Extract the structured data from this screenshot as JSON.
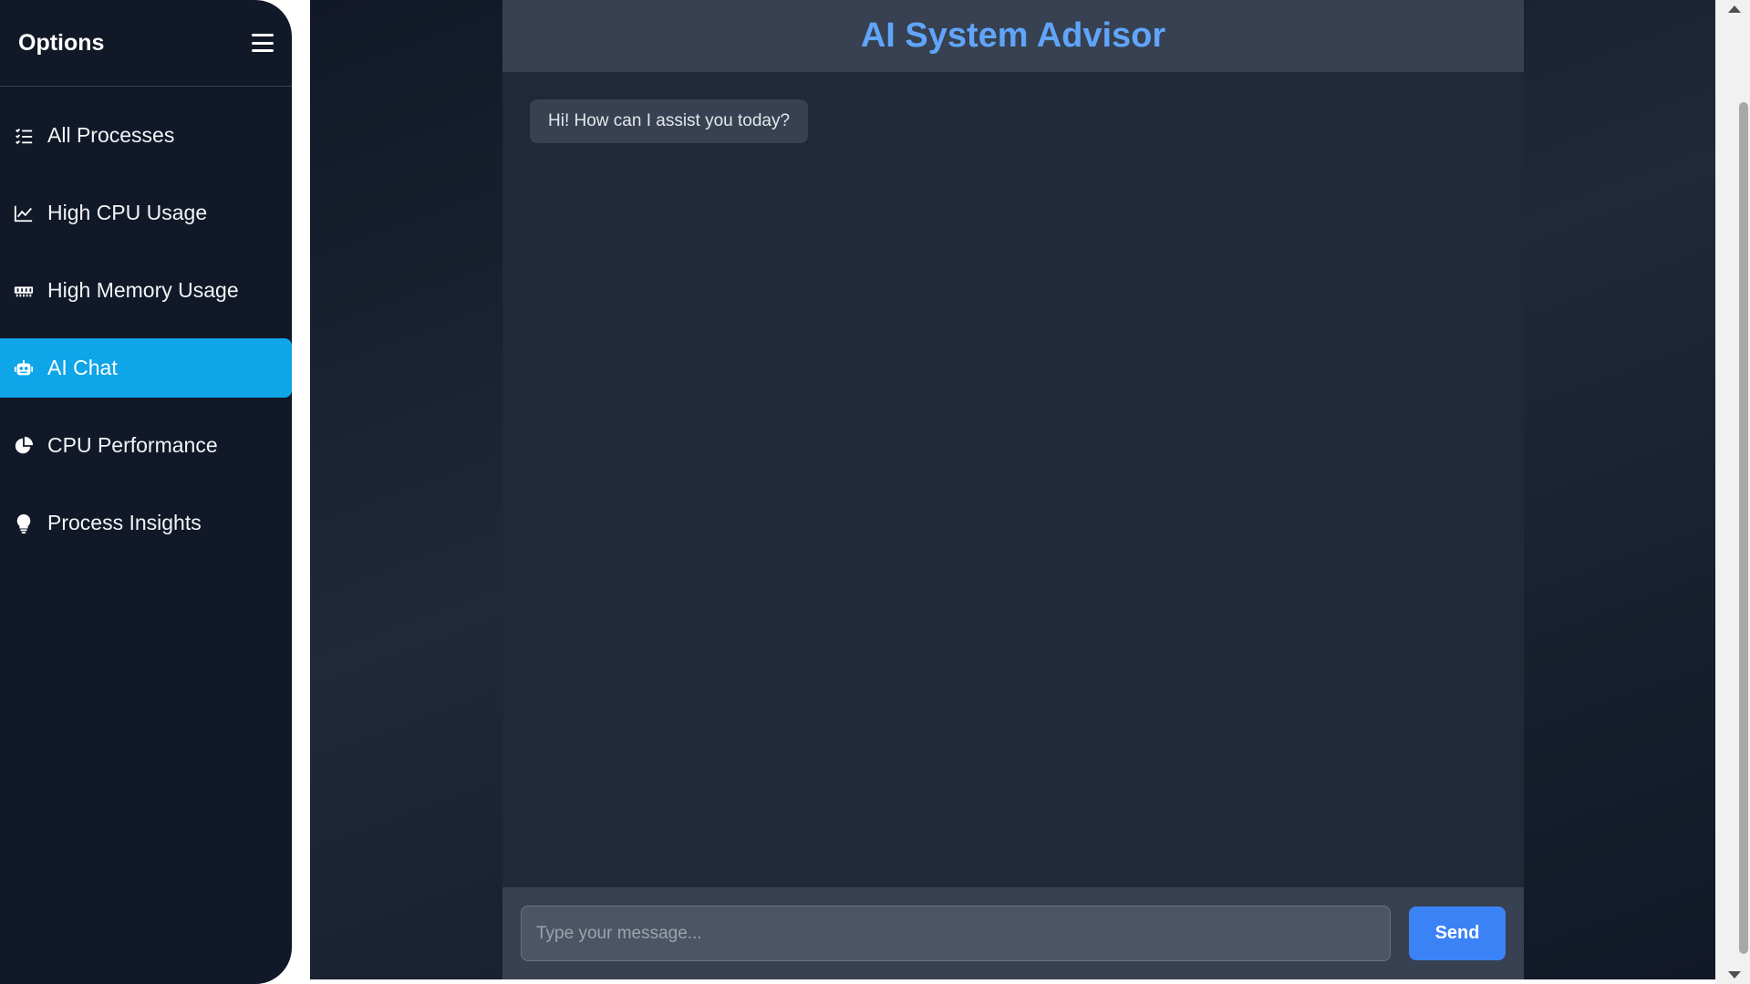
{
  "sidebar": {
    "title": "Options",
    "items": [
      {
        "label": "All Processes",
        "icon": "list-check-icon",
        "active": false
      },
      {
        "label": "High CPU Usage",
        "icon": "line-chart-icon",
        "active": false
      },
      {
        "label": "High Memory Usage",
        "icon": "memory-icon",
        "active": false
      },
      {
        "label": "AI Chat",
        "icon": "robot-icon",
        "active": true
      },
      {
        "label": "CPU Performance",
        "icon": "pie-chart-icon",
        "active": false
      },
      {
        "label": "Process Insights",
        "icon": "lightbulb-icon",
        "active": false
      }
    ]
  },
  "chat": {
    "title": "AI System Advisor",
    "messages": [
      {
        "from": "assistant",
        "text": "Hi! How can I assist you today?"
      }
    ],
    "input": {
      "value": "",
      "placeholder": "Type your message..."
    },
    "send_label": "Send"
  },
  "colors": {
    "accent": "#0ea5e9",
    "title": "#60a5fa",
    "send_button": "#3b82f6",
    "sidebar_bg": "#111827",
    "panel_bg": "#1f2937"
  }
}
